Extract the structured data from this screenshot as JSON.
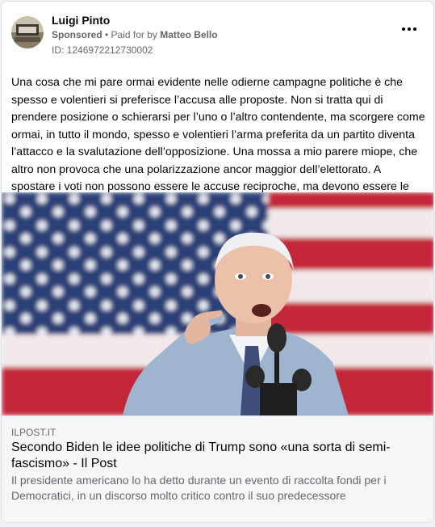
{
  "post": {
    "author": "Luigi Pinto",
    "sponsored": "Sponsored",
    "paid_for_prefix": " • Paid for by ",
    "payer": "Matteo Bello",
    "id_line": "ID: 1246972212730002",
    "text": "Una cosa che mi pare ormai evidente nelle odierne campagne politiche è che spesso e volentieri si preferisce l’accusa alle proposte. Non si tratta qui di prendere posizione o schierarsi per l’uno o l’altro contendente, ma scorgere come ormai, in tutto il mondo, spesso e volentieri l’arma preferita da un partito diventa l’attacco e la svalutazione dell’opposizione. Una mossa a mio parere miope, che altro non provoca che una polarizzazione ancor maggior dell’elettorato. A spostare i voti non possono essere le accuse reciproche, ma devono essere le idee, le..."
  },
  "link": {
    "domain": "ILPOST.IT",
    "title": "Secondo Biden le idee politiche di Trump sono «una sorta di semi-fascismo» - Il Post",
    "description": "Il presidente americano lo ha detto durante un evento di raccolta fondi per i Democratici, in un discorso molto critico contro il suo predecessore"
  }
}
